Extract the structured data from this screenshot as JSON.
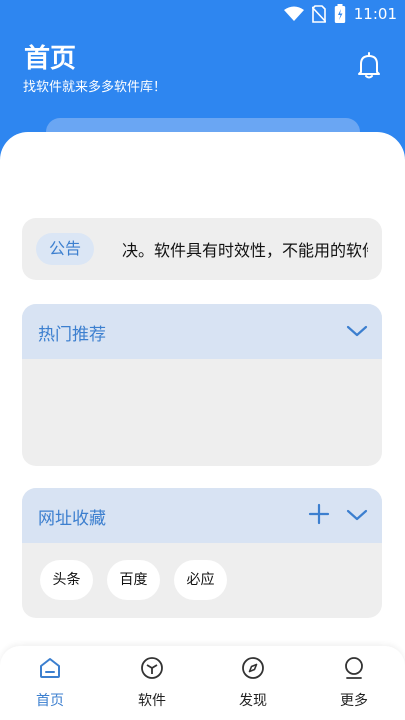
{
  "status": {
    "time": "11:01"
  },
  "header": {
    "title": "首页",
    "subtitle": "找软件就来多多软件库！"
  },
  "notice": {
    "tag": "公告",
    "text": "决。软件具有时效性，不能用的软件"
  },
  "hot": {
    "title": "热门推荐"
  },
  "favorites": {
    "title": "网址收藏",
    "chips": [
      "头条",
      "百度",
      "必应"
    ]
  },
  "tabs": [
    {
      "label": "首页",
      "icon": "home-icon",
      "active": true
    },
    {
      "label": "软件",
      "icon": "cube-icon",
      "active": false
    },
    {
      "label": "发现",
      "icon": "compass-icon",
      "active": false
    },
    {
      "label": "更多",
      "icon": "user-circle-icon",
      "active": false
    }
  ],
  "colors": {
    "primary": "#2e86f0",
    "accent": "#3c7fcf",
    "card_bg": "#eeeeee",
    "card_header": "#d8e3f3"
  }
}
